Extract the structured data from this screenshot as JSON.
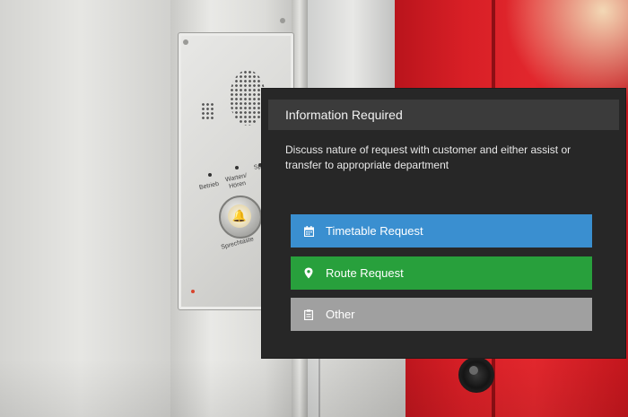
{
  "background": {
    "panel_labels": [
      "Betrieb",
      "Warten/ Hören",
      "Sp",
      "Sprechtaste"
    ]
  },
  "dialog": {
    "title": "Information Required",
    "message": "Discuss nature of request with customer and either assist or transfer to appropriate department",
    "options": [
      {
        "label": "Timetable Request",
        "icon": "calendar-icon",
        "color": "#3a8fd0"
      },
      {
        "label": "Route Request",
        "icon": "map-pin-icon",
        "color": "#28a03c"
      },
      {
        "label": "Other",
        "icon": "clipboard-icon",
        "color": "#a0a0a0"
      }
    ]
  },
  "colors": {
    "dialog_bg": "#272727",
    "header_bg": "#3b3b3b"
  }
}
